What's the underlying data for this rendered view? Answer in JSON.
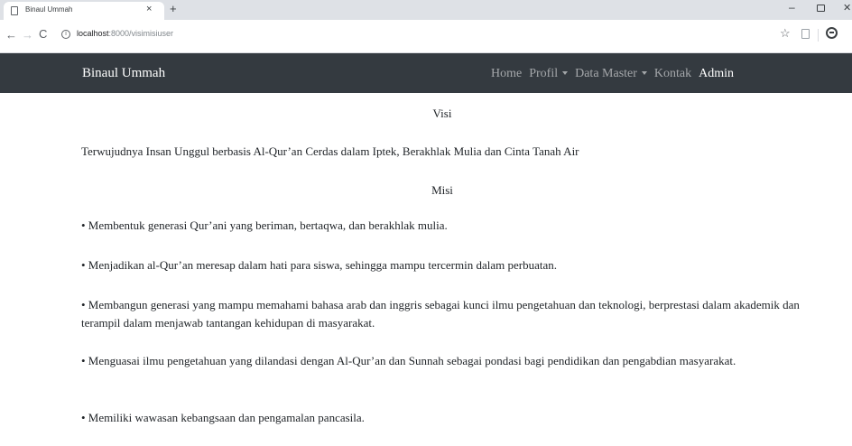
{
  "browser": {
    "tab_title": "Binaul Ummah",
    "tab_close": "×",
    "new_tab": "+",
    "url_host": "localhost",
    "url_path": ":8000/visimisiuser",
    "icons": [
      "page-icon",
      "close-icon",
      "plus-icon",
      "back-icon",
      "forward-icon",
      "reload-icon",
      "info-icon",
      "star-icon",
      "extension-icon",
      "account-icon",
      "minimize-icon",
      "maximize-icon",
      "window-close-icon"
    ]
  },
  "navbar": {
    "brand": "Binaul Ummah",
    "links": {
      "home": "Home",
      "profil": "Profil",
      "data_master": "Data Master",
      "kontak": "Kontak",
      "admin": "Admin"
    },
    "background": "#343a40"
  },
  "content": {
    "visi_title": "Visi",
    "visi_text": "Terwujudnya Insan Unggul berbasis Al-Qur’an Cerdas dalam Iptek, Berakhlak Mulia dan Cinta Tanah Air",
    "misi_title": "Misi",
    "misi_items": [
      "• Membentuk generasi Qur’ani yang beriman, bertaqwa, dan berakhlak mulia.",
      "• Menjadikan al-Qur’an meresap dalam hati para siswa, sehingga mampu tercermin dalam perbuatan.",
      "• Membangun generasi yang mampu memahami bahasa arab dan inggris sebagai kunci ilmu pengetahuan dan teknologi, berprestasi dalam akademik dan terampil dalam menjawab tantangan kehidupan di masyarakat.",
      "• Menguasai ilmu pengetahuan yang dilandasi dengan Al-Qur’an dan Sunnah sebagai pondasi bagi pendidikan dan pengabdian masyarakat.",
      "• Memiliki wawasan kebangsaan dan pengamalan pancasila."
    ]
  }
}
